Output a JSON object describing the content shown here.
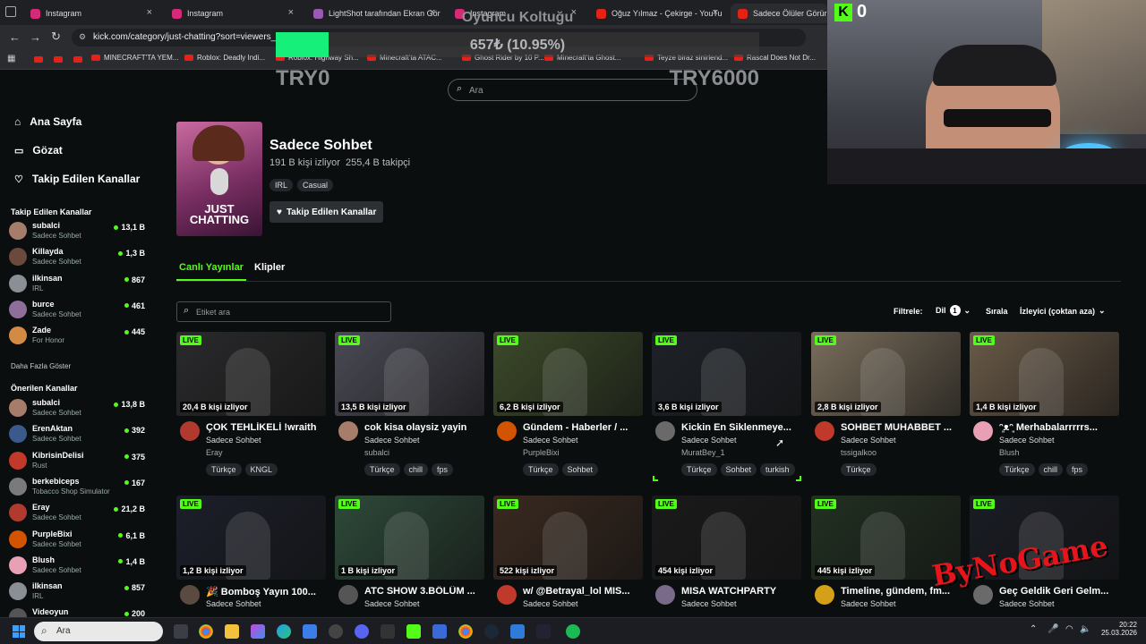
{
  "browser": {
    "tabs": [
      {
        "title": "Instagram",
        "color": "#d62976"
      },
      {
        "title": "Instagram",
        "color": "#d62976"
      },
      {
        "title": "LightShot tarafından Ekran Gör",
        "color": "#9b59b6"
      },
      {
        "title": "Instagram",
        "color": "#d62976"
      },
      {
        "title": "Oğuz Yılmaz - Çekirge - YouTu",
        "color": "#e62117"
      },
      {
        "title": "Sadece Ölüler Görür! Pa",
        "color": "#e62117"
      }
    ],
    "url": "kick.com/category/just-chatting?sort=viewers_hi",
    "bookmarks": [
      "MINECRAFT'TA YEM...",
      "Roblox: Deadly Indi...",
      "Roblox: Highway Sh...",
      "Minecraft'ta ATAC...",
      "Ghost Rider by 10 P...",
      "Minecraft'ta Ghost...",
      "Teyze biraz sinirlend...",
      "Rascal Does Not Dr..."
    ]
  },
  "overlay": {
    "title": "Oyuncu Koltuğu",
    "amount": "657₺ (10.95%)",
    "progress": 0.1095,
    "min": "TRY0",
    "max": "TRY6000"
  },
  "webcam": {
    "counter": "0",
    "logo": "K"
  },
  "kick": {
    "search_placeholder": "Ara",
    "nav": [
      {
        "label": "Ana Sayfa"
      },
      {
        "label": "Gözat"
      },
      {
        "label": "Takip Edilen Kanallar"
      }
    ],
    "followed_title": "Takip Edilen Kanallar",
    "followed": [
      {
        "name": "subalci",
        "cat": "Sadece Sohbet",
        "viewers": "13,1 B",
        "color": "#a67c6a"
      },
      {
        "name": "Killayda",
        "cat": "Sadece Sohbet",
        "viewers": "1,3 B",
        "color": "#6b4a3d"
      },
      {
        "name": "ilkinsan",
        "cat": "IRL",
        "viewers": "867",
        "color": "#8a8f95"
      },
      {
        "name": "burce",
        "cat": "Sadece Sohbet",
        "viewers": "461",
        "color": "#8e6f9c"
      },
      {
        "name": "Zade",
        "cat": "For Honor",
        "viewers": "445",
        "color": "#d28b42"
      }
    ],
    "show_more": "Daha Fazla Göster",
    "recommended_title": "Önerilen Kanallar",
    "recommended": [
      {
        "name": "subalci",
        "cat": "Sadece Sohbet",
        "viewers": "13,8 B",
        "color": "#a67c6a"
      },
      {
        "name": "ErenAktan",
        "cat": "Sadece Sohbet",
        "viewers": "392",
        "color": "#3a5a8c"
      },
      {
        "name": "KibrisinDelisi",
        "cat": "Rust",
        "viewers": "375",
        "color": "#c0392b"
      },
      {
        "name": "berkebiceps",
        "cat": "Tobacco Shop Simulator",
        "viewers": "167",
        "color": "#7a7a7a"
      },
      {
        "name": "Eray",
        "cat": "Sadece Sohbet",
        "viewers": "21,2 B",
        "color": "#b03a2e"
      },
      {
        "name": "PurpleBixi",
        "cat": "Sadece Sohbet",
        "viewers": "6,1 B",
        "color": "#d35400"
      },
      {
        "name": "Blush",
        "cat": "Sadece Sohbet",
        "viewers": "1,4 B",
        "color": "#e8a0b4"
      },
      {
        "name": "ilkinsan",
        "cat": "IRL",
        "viewers": "857",
        "color": "#8a8f95"
      },
      {
        "name": "Videoyun",
        "cat": "",
        "viewers": "200",
        "color": "#555"
      }
    ],
    "category": {
      "title": "Sadece Sohbet",
      "stats": "191 B kişi izliyor  255,4 B takipçi",
      "tags": [
        "IRL",
        "Casual"
      ],
      "follow_label": "Takip Edilen Kanallar",
      "cover_text": "JUST CHATTING"
    },
    "tabs": [
      {
        "label": "Canlı Yayınlar"
      },
      {
        "label": "Klipler"
      }
    ],
    "tag_search_placeholder": "Etiket ara",
    "filter_label": "Filtrele:",
    "lang_label": "Dil",
    "lang_count": "1",
    "sort_label": "Sırala",
    "sort_value": "İzleyici (çoktan aza)",
    "live_label": "LIVE",
    "streams": [
      {
        "viewers": "20,4 B kişi izliyor",
        "title": "ÇOK TEHLİKELİ !wraith",
        "category": "Sadece Sohbet",
        "streamer": "Eray",
        "tags": [
          "Türkçe",
          "KNGL"
        ],
        "bg": "#2a2a2c",
        "av": "#b03a2e"
      },
      {
        "viewers": "13,5 B kişi izliyor",
        "title": "cok kisa olaysiz yayin",
        "category": "Sadece Sohbet",
        "streamer": "subalci",
        "tags": [
          "Türkçe",
          "chill",
          "fps"
        ],
        "bg": "#4a4a55",
        "av": "#a67c6a"
      },
      {
        "viewers": "6,2 B kişi izliyor",
        "title": "Gündem - Haberler / ...",
        "category": "Sadece Sohbet",
        "streamer": "PurpleBixi",
        "tags": [
          "Türkçe",
          "Sohbet"
        ],
        "bg": "#3c4a2a",
        "av": "#d35400"
      },
      {
        "viewers": "3,6 B kişi izliyor",
        "title": "Kickin En Siklenmeye...",
        "category": "Sadece Sohbet",
        "streamer": "MuratBey_1",
        "tags": [
          "Türkçe",
          "Sohbet",
          "turkish"
        ],
        "bg": "#1e2228",
        "av": "#6a6a6a"
      },
      {
        "viewers": "2,8 B kişi izliyor",
        "title": "SOHBET MUHABBET ...",
        "category": "Sadece Sohbet",
        "streamer": "tssigalkoo",
        "tags": [
          "Türkçe"
        ],
        "bg": "#7a6e5c",
        "av": "#c0392b"
      },
      {
        "viewers": "1,4 B kişi izliyor",
        "title": "ᵔ͈ᴥᵔ͈ Merhabalarrrrrs...",
        "category": "Sadece Sohbet",
        "streamer": "Blush",
        "tags": [
          "Türkçe",
          "chill",
          "fps"
        ],
        "bg": "#6a5a48",
        "av": "#e8a0b4"
      },
      {
        "viewers": "1,2 B kişi izliyor",
        "title": "🎉 Bomboş Yayın 100...",
        "category": "Sadece Sohbet",
        "streamer": "",
        "tags": [],
        "bg": "#1c1f2a",
        "av": "#5a4a40"
      },
      {
        "viewers": "1 B kişi izliyor",
        "title": "ATC SHOW 3.BÖLÜM ...",
        "category": "Sadece Sohbet",
        "streamer": "",
        "tags": [],
        "bg": "#2e4a3a",
        "av": "#555"
      },
      {
        "viewers": "522 kişi izliyor",
        "title": "w/ @Betrayal_lol MIS...",
        "category": "Sadece Sohbet",
        "streamer": "",
        "tags": [],
        "bg": "#3a2a20",
        "av": "#c0392b"
      },
      {
        "viewers": "454 kişi izliyor",
        "title": "MISA WATCHPARTY",
        "category": "Sadece Sohbet",
        "streamer": "",
        "tags": [],
        "bg": "#1a1a1a",
        "av": "#7a6a8a"
      },
      {
        "viewers": "445 kişi izliyor",
        "title": "Timeline, gündem, fm...",
        "category": "Sadece Sohbet",
        "streamer": "",
        "tags": [],
        "bg": "#223022",
        "av": "#d4a017"
      },
      {
        "viewers": "",
        "title": "Geç Geldik Geri Gelm...",
        "category": "Sadece Sohbet",
        "streamer": "",
        "tags": [],
        "bg": "#1a1c24",
        "av": "#6a6a6a"
      }
    ]
  },
  "taskbar": {
    "search": "Ara",
    "time": "20:22",
    "date": "25.03.2026"
  }
}
